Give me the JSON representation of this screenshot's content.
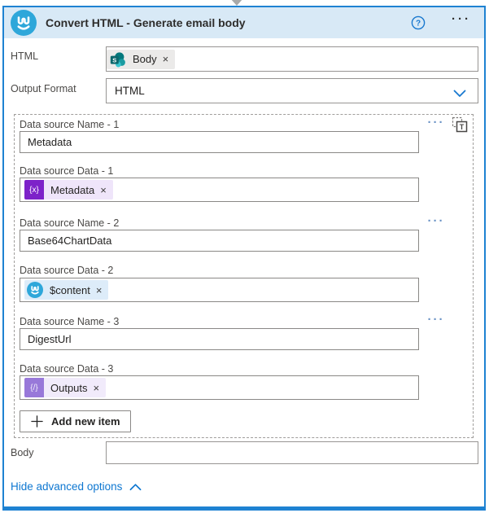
{
  "header": {
    "title": "Convert HTML - Generate email body",
    "help_glyph": "?",
    "menu_glyph": "···"
  },
  "fields": {
    "html": {
      "label": "HTML",
      "token": {
        "icon": "sharepoint-icon",
        "text": "Body",
        "close_glyph": "×"
      }
    },
    "output_format": {
      "label": "Output Format",
      "value": "HTML"
    },
    "body": {
      "label": "Body",
      "value": ""
    }
  },
  "data_sources": {
    "item_menu_glyph": "···",
    "items": [
      {
        "name_label": "Data source Name - 1",
        "name_value": "Metadata",
        "data_label": "Data source Data - 1",
        "token": {
          "icon": "variable-icon",
          "icon_glyph": "{x}",
          "text": "Metadata",
          "close_glyph": "×"
        }
      },
      {
        "name_label": "Data source Name - 2",
        "name_value": "Base64ChartData",
        "data_label": "Data source Data - 2",
        "token": {
          "icon": "encodian-icon",
          "text": "$content",
          "close_glyph": "×"
        }
      },
      {
        "name_label": "Data source Name - 3",
        "name_value": "DigestUrl",
        "data_label": "Data source Data - 3",
        "token": {
          "icon": "outputs-icon",
          "icon_glyph": "{/}",
          "text": "Outputs",
          "close_glyph": "×"
        }
      }
    ],
    "add_button_label": "Add new item",
    "array_toggle_glyph": "T"
  },
  "footer": {
    "link_label": "Hide advanced options"
  },
  "colors": {
    "card_border": "#1e82d2",
    "header_bg": "#d8e9f6",
    "brand_teal": "#2ea7da",
    "link_blue": "#0e77d1",
    "variable_purple": "#7d22c9",
    "outputs_purple": "#9878d9",
    "token_gray_bg": "#ebeae9",
    "token_purple_bg": "#efe5fa",
    "token_blue_bg": "#ddecf9",
    "token_lilac_bg": "#f1ebfb"
  }
}
